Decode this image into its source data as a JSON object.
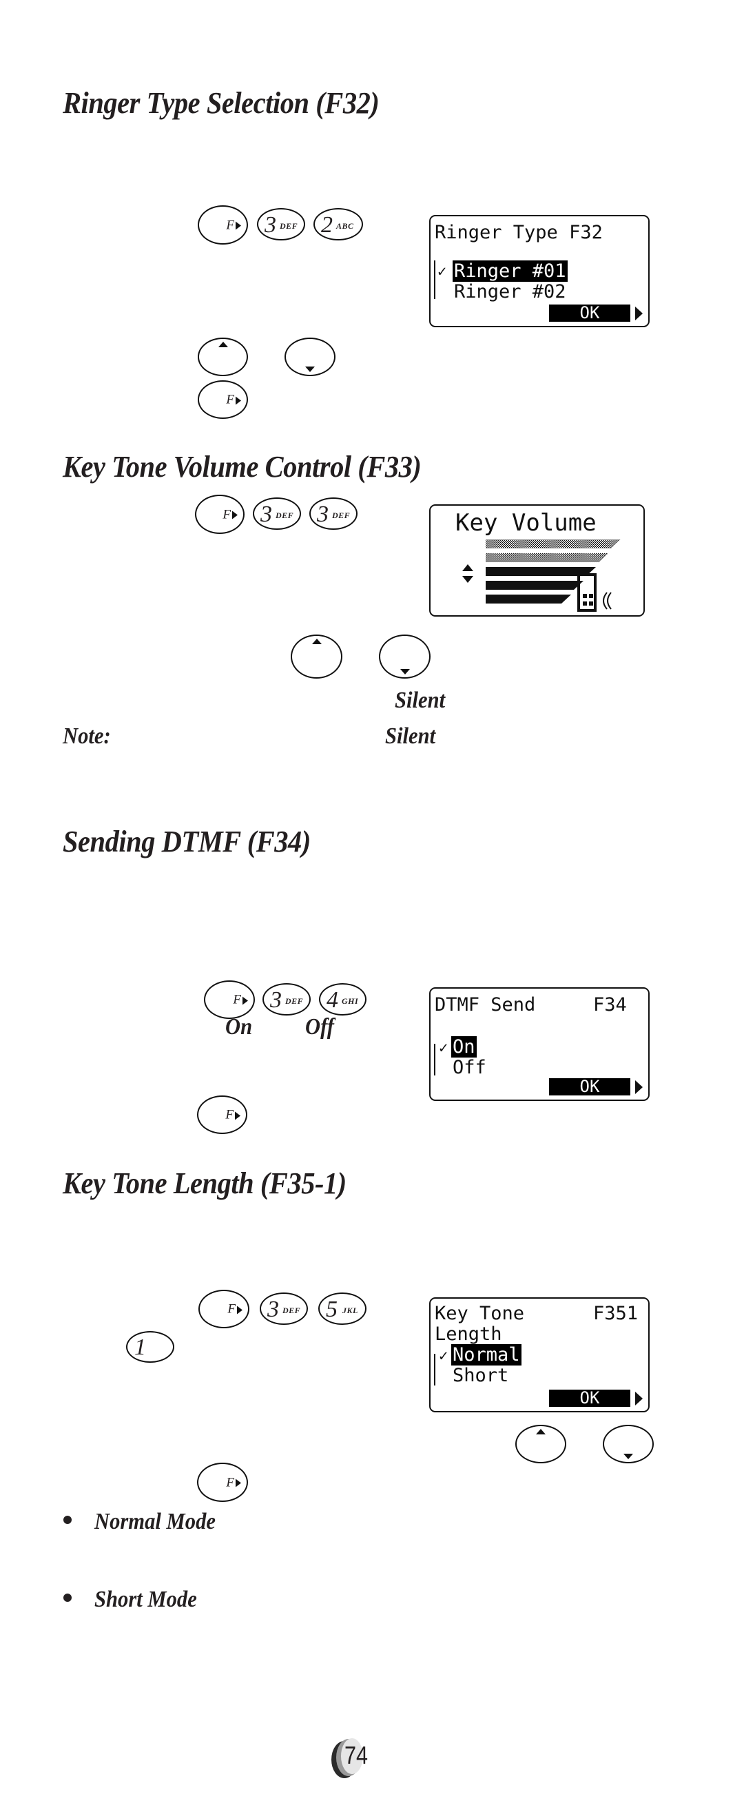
{
  "sections": {
    "ringer": {
      "title": "Ringer Type Selection (F32)",
      "keys": [
        {
          "type": "function",
          "label": "F"
        },
        {
          "type": "digit",
          "num": "3",
          "sub": "DEF"
        },
        {
          "type": "digit",
          "num": "2",
          "sub": "ABC"
        }
      ],
      "screen": {
        "title": "Ringer Type F32",
        "options": [
          "Ringer #01",
          "Ringer #02"
        ],
        "selected_index": 0,
        "ok_label": "OK"
      },
      "nav_keys": [
        "up",
        "down"
      ],
      "confirm_key": {
        "type": "function",
        "label": "F"
      }
    },
    "key_volume": {
      "title": "Key Tone Volume Control (F33)",
      "keys": [
        {
          "type": "function",
          "label": "F"
        },
        {
          "type": "digit",
          "num": "3",
          "sub": "DEF"
        },
        {
          "type": "digit",
          "num": "3",
          "sub": "DEF"
        }
      ],
      "screen": {
        "title": "Key Volume",
        "level": 3,
        "max_level": 5
      },
      "nav_keys": [
        "up",
        "down"
      ],
      "silent_label": "Silent",
      "note_label": "Note:",
      "note_silent_label": "Silent"
    },
    "dtmf": {
      "title": "Sending DTMF (F34)",
      "keys": [
        {
          "type": "function",
          "label": "F"
        },
        {
          "type": "digit",
          "num": "3",
          "sub": "DEF"
        },
        {
          "type": "digit",
          "num": "4",
          "sub": "GHI"
        }
      ],
      "on_label": "On",
      "off_label": "Off",
      "screen": {
        "title_left": "DTMF Send",
        "title_right": "F34",
        "options": [
          "On",
          "Off"
        ],
        "selected_index": 0,
        "ok_label": "OK"
      },
      "confirm_key": {
        "type": "function",
        "label": "F"
      }
    },
    "key_length": {
      "title": "Key Tone Length (F35-1)",
      "keys": [
        {
          "type": "function",
          "label": "F"
        },
        {
          "type": "digit",
          "num": "3",
          "sub": "DEF"
        },
        {
          "type": "digit",
          "num": "5",
          "sub": "JKL"
        }
      ],
      "extra_key": {
        "type": "digit",
        "num": "1",
        "sub": ""
      },
      "screen": {
        "title_left": "Key Tone",
        "title_right": "F351",
        "title_line2": "Length",
        "options": [
          "Normal",
          "Short"
        ],
        "selected_index": 0,
        "ok_label": "OK"
      },
      "nav_keys": [
        "up",
        "down"
      ],
      "confirm_key": {
        "type": "function",
        "label": "F"
      },
      "bullets": [
        "Normal Mode",
        "Short Mode"
      ]
    }
  },
  "icons": {
    "check": "✓",
    "function_key": "F"
  },
  "page_number": "74"
}
